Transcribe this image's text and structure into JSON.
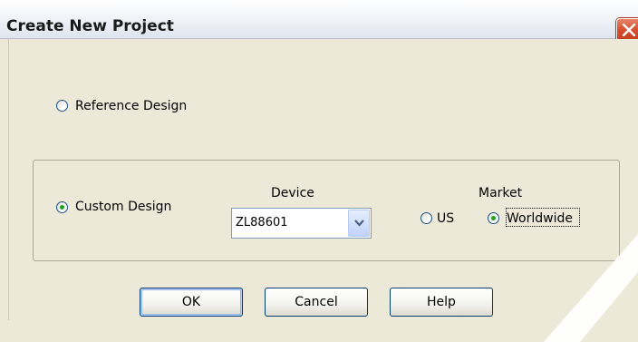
{
  "window": {
    "title": "Create New Project"
  },
  "options": {
    "reference_design_label": "Reference Design",
    "reference_design_selected": false,
    "custom_design_label": "Custom Design",
    "custom_design_selected": true
  },
  "device": {
    "label": "Device",
    "value": "ZL88601"
  },
  "market": {
    "label": "Market",
    "us_label": "US",
    "us_selected": false,
    "worldwide_label": "Worldwide",
    "worldwide_selected": true
  },
  "buttons": {
    "ok_label": "OK",
    "cancel_label": "Cancel",
    "help_label": "Help"
  },
  "colors": {
    "radio_dot": "#21a121",
    "close_button": "#d6502f",
    "dialog_background": "#ece9d8"
  },
  "icons": {
    "close": "close-icon",
    "dropdown": "chevron-down-icon"
  }
}
